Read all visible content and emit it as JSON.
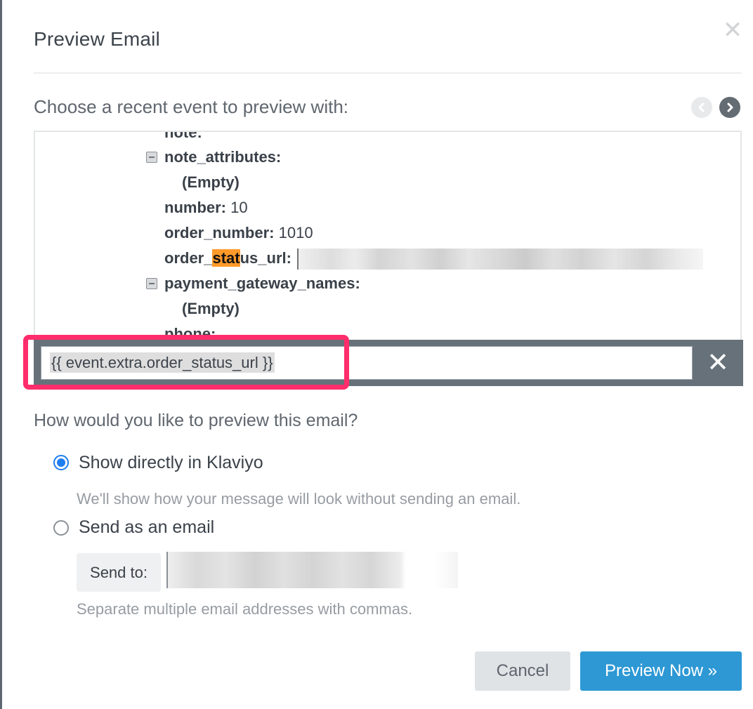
{
  "dialog": {
    "title": "Preview Email",
    "close_icon": "close-icon"
  },
  "event_picker": {
    "label": "Choose a recent event to preview with:",
    "prev_icon": "chevron-left-icon",
    "next_icon": "chevron-right-icon",
    "tree": [
      {
        "key": "note:",
        "value": "",
        "collapsible": false,
        "indent": 1,
        "partial": true
      },
      {
        "key": "note_attributes:",
        "value": "",
        "collapsible": true,
        "indent": 1
      },
      {
        "key": "(Empty)",
        "value": "",
        "collapsible": false,
        "indent": 2
      },
      {
        "key": "number:",
        "value": "10",
        "collapsible": false,
        "indent": 1
      },
      {
        "key": "order_number:",
        "value": "1010",
        "collapsible": false,
        "indent": 1
      },
      {
        "key_prefix": "order_",
        "key_highlight": "stat",
        "key_suffix": "us_url:",
        "value": "[redacted]",
        "collapsible": false,
        "indent": 1
      },
      {
        "key": "payment_gateway_names:",
        "value": "",
        "collapsible": true,
        "indent": 1
      },
      {
        "key": "(Empty)",
        "value": "",
        "collapsible": false,
        "indent": 2
      },
      {
        "key": "phone:",
        "value": "",
        "collapsible": false,
        "indent": 1,
        "partial": true
      }
    ],
    "search": {
      "value": "{{ event.extra.order_status_url }}",
      "clear_icon": "close-icon"
    },
    "highlight_color": "#ff9a2a",
    "annotation_color": "#ff2d6b"
  },
  "preview_mode": {
    "question": "How would you like to preview this email?",
    "options": [
      {
        "label": "Show directly in Klaviyo",
        "checked": true,
        "help": "We'll show how your message will look without sending an email."
      },
      {
        "label": "Send as an email",
        "checked": false
      }
    ],
    "send_to": {
      "addon_label": "Send to:",
      "value": "[redacted]",
      "help": "Separate multiple email addresses with commas."
    }
  },
  "footer": {
    "cancel_label": "Cancel",
    "preview_label": "Preview Now »",
    "primary_color": "#2d98d4"
  }
}
